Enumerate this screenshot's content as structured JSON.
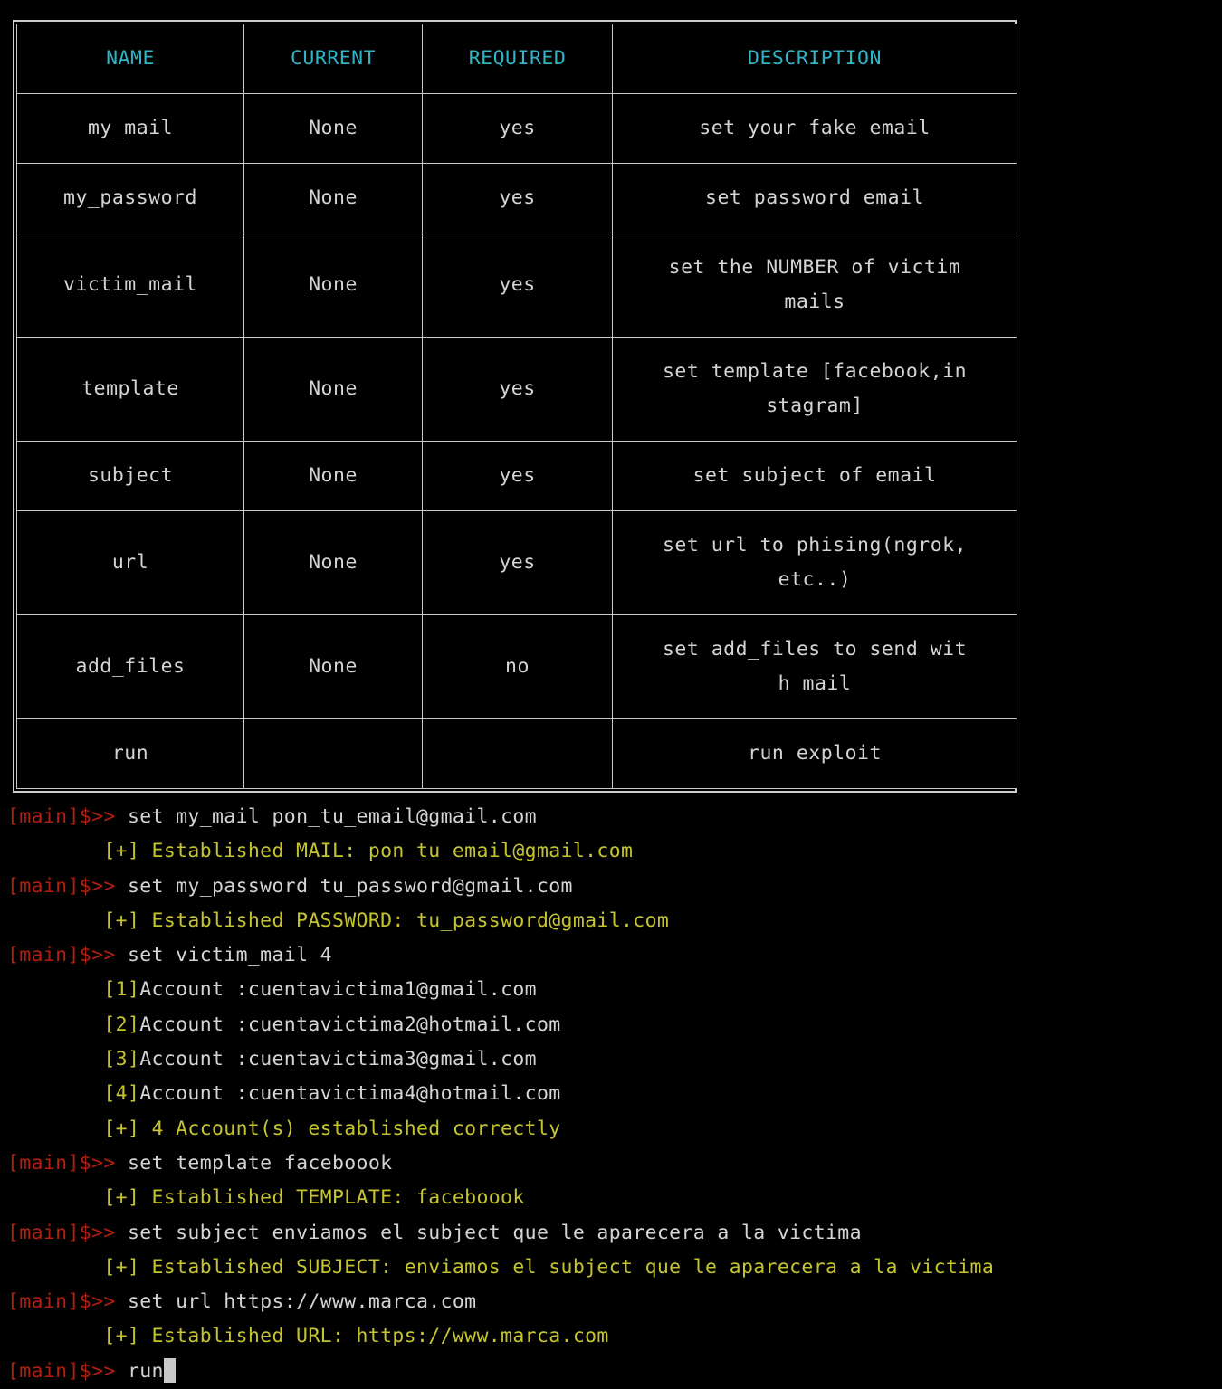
{
  "options_table": {
    "headers": [
      "NAME",
      "CURRENT",
      "REQUIRED",
      "DESCRIPTION"
    ],
    "header_color": "#2eb4c6",
    "border_color": "#c8c8c8",
    "rows": [
      {
        "name": "my_mail",
        "current": "None",
        "required": "yes",
        "description": "set your fake email"
      },
      {
        "name": "my_password",
        "current": "None",
        "required": "yes",
        "description": "set password email"
      },
      {
        "name": "victim_mail",
        "current": "None",
        "required": "yes",
        "description": "set the NUMBER of victim\nmails"
      },
      {
        "name": "template",
        "current": "None",
        "required": "yes",
        "description": "set template [facebook,in\nstagram]"
      },
      {
        "name": "subject",
        "current": "None",
        "required": "yes",
        "description": "set subject of email"
      },
      {
        "name": "url",
        "current": "None",
        "required": "yes",
        "description": "set url to phising(ngrok,\netc..)"
      },
      {
        "name": "add_files",
        "current": "None",
        "required": "no",
        "description": "set add_files to send wit\nh mail"
      },
      {
        "name": "run",
        "current": "",
        "required": "",
        "description": "run exploit"
      }
    ]
  },
  "terminal": {
    "prompt": "[main]$>>",
    "indent": "        ",
    "colors": {
      "prompt": "#b21e10",
      "success": "#c6c42e",
      "text": "#d4d4d4",
      "cursor": "#c9c9c9"
    },
    "lines": [
      {
        "type": "command",
        "prompt": "[main]$>>",
        "command": " set my_mail pon_tu_email@gmail.com"
      },
      {
        "type": "success",
        "text": "        [+] Established MAIL: pon_tu_email@gmail.com"
      },
      {
        "type": "command",
        "prompt": "[main]$>>",
        "command": " set my_password tu_password@gmail.com"
      },
      {
        "type": "success",
        "text": "        [+] Established PASSWORD: tu_password@gmail.com"
      },
      {
        "type": "command",
        "prompt": "[main]$>>",
        "command": " set victim_mail 4"
      },
      {
        "type": "account",
        "indent": "        ",
        "index": "[1]",
        "text": "Account :cuentavictima1@gmail.com"
      },
      {
        "type": "account",
        "indent": "        ",
        "index": "[2]",
        "text": "Account :cuentavictima2@hotmail.com"
      },
      {
        "type": "account",
        "indent": "        ",
        "index": "[3]",
        "text": "Account :cuentavictima3@gmail.com"
      },
      {
        "type": "account",
        "indent": "        ",
        "index": "[4]",
        "text": "Account :cuentavictima4@hotmail.com"
      },
      {
        "type": "success",
        "text": "        [+] 4 Account(s) established correctly"
      },
      {
        "type": "command",
        "prompt": "[main]$>>",
        "command": " set template faceboook"
      },
      {
        "type": "success",
        "text": "        [+] Established TEMPLATE: faceboook"
      },
      {
        "type": "command",
        "prompt": "[main]$>>",
        "command": " set subject enviamos el subject que le aparecera a la victima"
      },
      {
        "type": "success",
        "text": "        [+] Established SUBJECT: enviamos el subject que le aparecera a la victima"
      },
      {
        "type": "command",
        "prompt": "[main]$>>",
        "command": " set url https://www.marca.com"
      },
      {
        "type": "success",
        "text": "        [+] Established URL: https://www.marca.com"
      },
      {
        "type": "cursor_command",
        "prompt": "[main]$>>",
        "command": " run"
      }
    ]
  }
}
